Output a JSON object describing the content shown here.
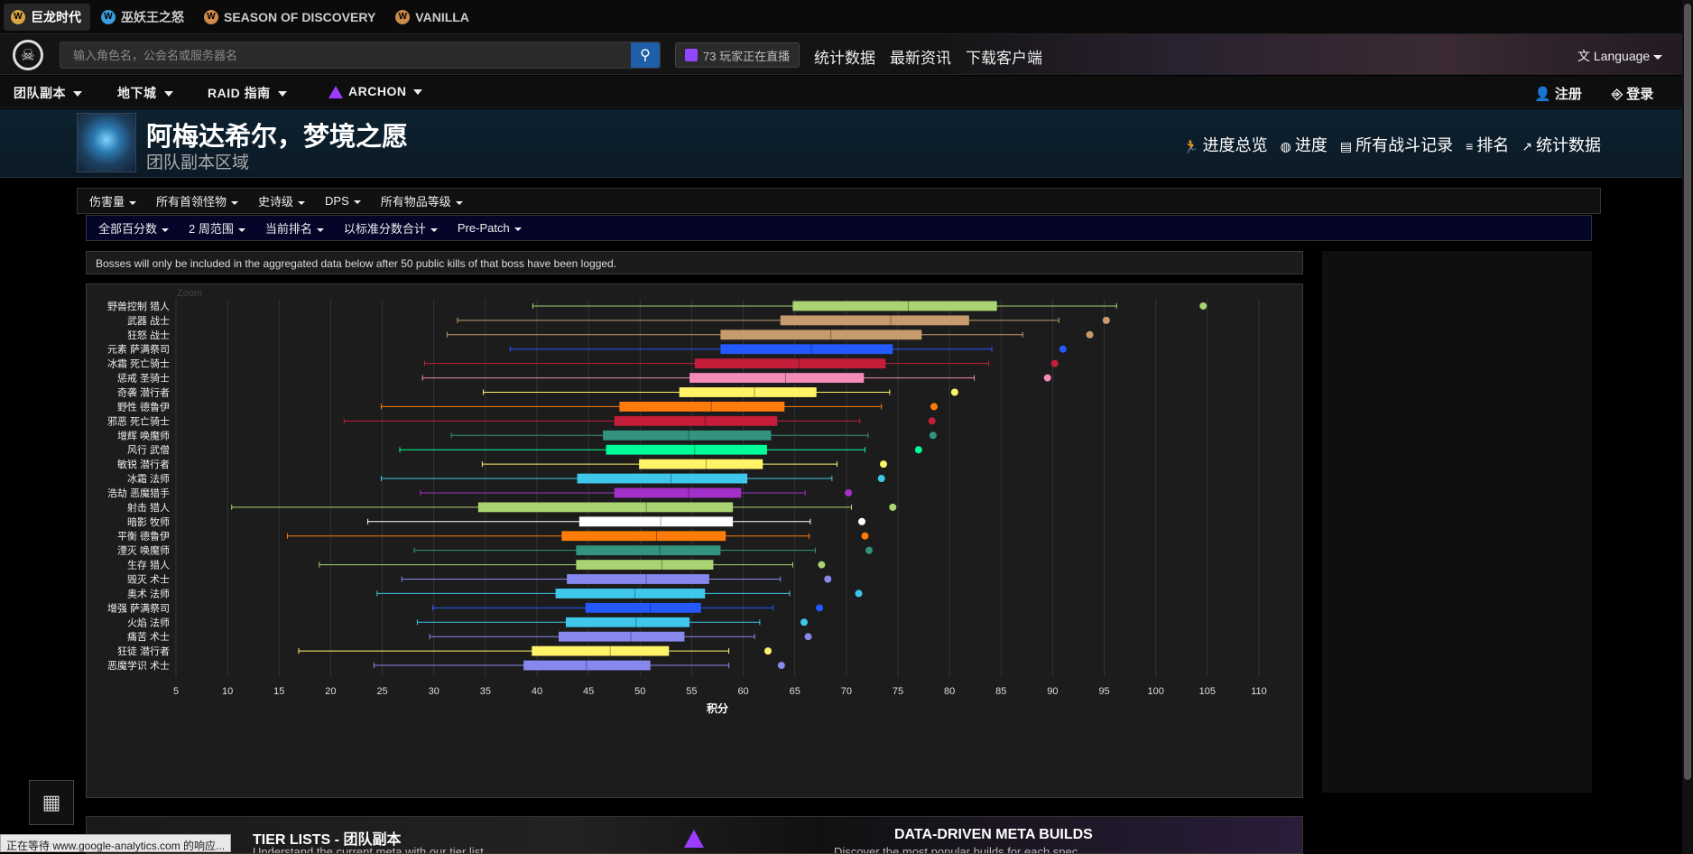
{
  "game_tabs": [
    {
      "label": "巨龙时代",
      "color": "#d9a441",
      "active": true
    },
    {
      "label": "巫妖王之怒",
      "color": "#3b9bdd",
      "active": false
    },
    {
      "label": "SEASON OF DISCOVERY",
      "color": "#d08a4a",
      "active": false
    },
    {
      "label": "VANILLA",
      "color": "#c98a4a",
      "active": false
    }
  ],
  "header": {
    "search_placeholder": "输入角色名，公会名或服务器名",
    "live_text": "73 玩家正在直播",
    "nav": [
      "统计数据",
      "最新资讯",
      "下载客户端"
    ],
    "language": "Language"
  },
  "navbar": {
    "items": [
      "团队副本",
      "地下城",
      "RAID 指南",
      "ARCHON"
    ],
    "register": "注册",
    "login": "登录"
  },
  "zone": {
    "title": "阿梅达希尔，梦境之愿",
    "subtitle": "团队副本区域",
    "links": [
      "进度总览",
      "进度",
      "所有战斗记录",
      "排名",
      "统计数据"
    ]
  },
  "filters_row1": [
    "伤害量",
    "所有首领怪物",
    "史诗级",
    "DPS",
    "所有物品等级"
  ],
  "filters_row2": [
    "全部百分数",
    "2 周范围",
    "当前排名",
    "以标准分数合计",
    "Pre-Patch"
  ],
  "notice": "Bosses will only be included in the aggregated data below after 50 public kills of that boss have been logged.",
  "chart_data": {
    "type": "box",
    "zoom_label": "Zoom",
    "xlabel": "积分",
    "xlim": [
      5,
      112
    ],
    "xticks": [
      5,
      10,
      15,
      20,
      25,
      30,
      35,
      40,
      45,
      50,
      55,
      60,
      65,
      70,
      75,
      80,
      85,
      90,
      95,
      100,
      105,
      110
    ],
    "series": [
      {
        "name": "野兽控制 猎人",
        "color": "#aad372",
        "min": 39.6,
        "q1": 64.8,
        "median": 76.0,
        "q3": 84.6,
        "max": 96.2,
        "outlier": 104.6
      },
      {
        "name": "武器 战士",
        "color": "#c69b6d",
        "min": 32.3,
        "q1": 63.6,
        "median": 74.3,
        "q3": 81.9,
        "max": 90.6,
        "outlier": 95.2
      },
      {
        "name": "狂怒 战士",
        "color": "#c69b6d",
        "min": 31.3,
        "q1": 57.8,
        "median": 68.5,
        "q3": 77.3,
        "max": 87.1,
        "outlier": 93.6
      },
      {
        "name": "元素 萨满祭司",
        "color": "#2459ff",
        "min": 37.4,
        "q1": 57.8,
        "median": 66.6,
        "q3": 74.5,
        "max": 84.1,
        "outlier": 91.0
      },
      {
        "name": "冰霜 死亡骑士",
        "color": "#c41e3a",
        "min": 29.1,
        "q1": 55.3,
        "median": 65.4,
        "q3": 73.8,
        "max": 83.8,
        "outlier": 90.2
      },
      {
        "name": "惩戒 圣骑士",
        "color": "#f48cba",
        "min": 28.9,
        "q1": 54.8,
        "median": 64.1,
        "q3": 71.7,
        "max": 82.4,
        "outlier": 89.5
      },
      {
        "name": "奇袭 潜行者",
        "color": "#fff468",
        "min": 34.8,
        "q1": 53.8,
        "median": 61.1,
        "q3": 67.1,
        "max": 74.2,
        "outlier": 80.5
      },
      {
        "name": "野性 德鲁伊",
        "color": "#ff7c0a",
        "min": 24.9,
        "q1": 48.0,
        "median": 56.9,
        "q3": 64.0,
        "max": 73.4,
        "outlier": 78.5
      },
      {
        "name": "邪恶 死亡骑士",
        "color": "#c41e3a",
        "min": 21.3,
        "q1": 47.5,
        "median": 56.3,
        "q3": 63.3,
        "max": 71.3,
        "outlier": 78.3
      },
      {
        "name": "增辉 唤魔师",
        "color": "#33937f",
        "min": 31.7,
        "q1": 46.4,
        "median": 54.7,
        "q3": 62.7,
        "max": 72.1,
        "outlier": 78.4
      },
      {
        "name": "风行 武僧",
        "color": "#00ff98",
        "min": 26.7,
        "q1": 46.7,
        "median": 55.3,
        "q3": 62.3,
        "max": 71.8,
        "outlier": 77.0
      },
      {
        "name": "敏锐 潜行者",
        "color": "#fff468",
        "min": 34.7,
        "q1": 49.9,
        "median": 56.4,
        "q3": 61.9,
        "max": 69.1,
        "outlier": 73.6
      },
      {
        "name": "冰霜 法师",
        "color": "#3fc7eb",
        "min": 24.9,
        "q1": 43.9,
        "median": 53.0,
        "q3": 60.4,
        "max": 68.6,
        "outlier": 73.4
      },
      {
        "name": "浩劫 恶魔猎手",
        "color": "#a330c9",
        "min": 28.7,
        "q1": 47.5,
        "median": 54.7,
        "q3": 59.8,
        "max": 66.0,
        "outlier": 70.2
      },
      {
        "name": "射击 猎人",
        "color": "#aad372",
        "min": 10.4,
        "q1": 34.3,
        "median": 50.6,
        "q3": 59.0,
        "max": 70.5,
        "outlier": 74.5
      },
      {
        "name": "暗影 牧师",
        "color": "#ffffff",
        "min": 23.6,
        "q1": 44.1,
        "median": 52.0,
        "q3": 59.0,
        "max": 66.5,
        "outlier": 71.5
      },
      {
        "name": "平衡 德鲁伊",
        "color": "#ff7c0a",
        "min": 15.8,
        "q1": 42.4,
        "median": 51.6,
        "q3": 58.3,
        "max": 66.4,
        "outlier": 71.8
      },
      {
        "name": "湮灭 唤魔师",
        "color": "#33937f",
        "min": 28.1,
        "q1": 43.8,
        "median": 51.9,
        "q3": 57.8,
        "max": 67.0,
        "outlier": 72.2
      },
      {
        "name": "生存 猎人",
        "color": "#aad372",
        "min": 18.9,
        "q1": 43.8,
        "median": 52.1,
        "q3": 57.1,
        "max": 64.8,
        "outlier": 67.6
      },
      {
        "name": "毁灭 术士",
        "color": "#8788ee",
        "min": 26.9,
        "q1": 42.9,
        "median": 50.6,
        "q3": 56.7,
        "max": 63.6,
        "outlier": 68.2
      },
      {
        "name": "奥术 法师",
        "color": "#3fc7eb",
        "min": 24.5,
        "q1": 41.8,
        "median": 49.5,
        "q3": 56.3,
        "max": 64.5,
        "outlier": 71.2
      },
      {
        "name": "增强 萨满祭司",
        "color": "#2459ff",
        "min": 29.9,
        "q1": 44.7,
        "median": 51.0,
        "q3": 55.9,
        "max": 62.9,
        "outlier": 67.4
      },
      {
        "name": "火焰 法师",
        "color": "#3fc7eb",
        "min": 28.4,
        "q1": 42.8,
        "median": 49.6,
        "q3": 54.8,
        "max": 61.6,
        "outlier": 65.9
      },
      {
        "name": "痛苦 术士",
        "color": "#8788ee",
        "min": 29.6,
        "q1": 42.1,
        "median": 49.1,
        "q3": 54.3,
        "max": 61.1,
        "outlier": 66.3
      },
      {
        "name": "狂徒 潜行者",
        "color": "#fff468",
        "min": 16.9,
        "q1": 39.5,
        "median": 47.1,
        "q3": 52.8,
        "max": 58.6,
        "outlier": 62.4
      },
      {
        "name": "恶魔学识 术士",
        "color": "#8788ee",
        "min": 24.2,
        "q1": 38.7,
        "median": 44.8,
        "q3": 51.0,
        "max": 58.6,
        "outlier": 63.7
      }
    ]
  },
  "banner": {
    "left_title": "TIER LISTS - 团队副本",
    "left_sub": "Understand the current meta with our tier list",
    "right_title": "DATA-DRIVEN META BUILDS",
    "right_sub": "Discover the most popular builds for each spec"
  },
  "status_text": "正在等待 www.google-analytics.com 的响应..."
}
